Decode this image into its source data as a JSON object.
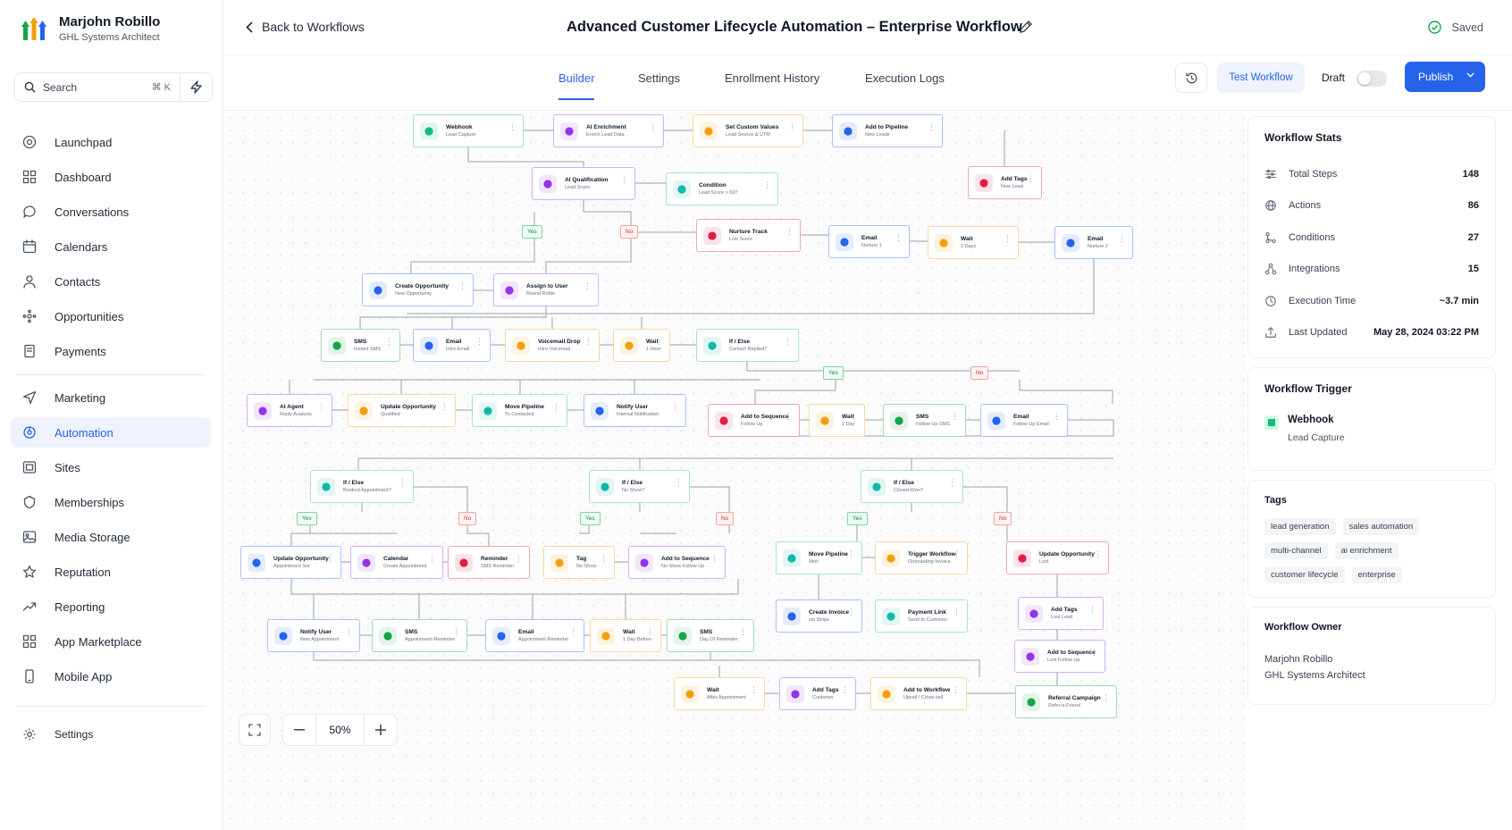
{
  "user": {
    "name": "Marjohn Robillo",
    "role": "GHL Systems Architect"
  },
  "search": {
    "label": "Search",
    "shortcut": "⌘ K"
  },
  "nav": {
    "main": [
      {
        "label": "Launchpad",
        "icon": "launchpad-icon"
      },
      {
        "label": "Dashboard",
        "icon": "dashboard-icon"
      },
      {
        "label": "Conversations",
        "icon": "chat-icon"
      },
      {
        "label": "Calendars",
        "icon": "calendar-icon"
      },
      {
        "label": "Contacts",
        "icon": "contacts-icon"
      },
      {
        "label": "Opportunities",
        "icon": "opportunities-icon"
      },
      {
        "label": "Payments",
        "icon": "payments-icon"
      }
    ],
    "secondary": [
      {
        "label": "Marketing",
        "icon": "send-icon"
      },
      {
        "label": "Automation",
        "icon": "automation-icon",
        "active": true
      },
      {
        "label": "Sites",
        "icon": "sites-icon"
      },
      {
        "label": "Memberships",
        "icon": "memberships-icon"
      },
      {
        "label": "Media Storage",
        "icon": "image-icon"
      },
      {
        "label": "Reputation",
        "icon": "star-icon"
      },
      {
        "label": "Reporting",
        "icon": "trend-icon"
      },
      {
        "label": "App Marketplace",
        "icon": "apps-icon"
      },
      {
        "label": "Mobile App",
        "icon": "phone-icon"
      }
    ],
    "settings": "Settings"
  },
  "header": {
    "back": "Back to Workflows",
    "title": "Advanced Customer Lifecycle Automation – Enterprise Workflow",
    "saved": "Saved"
  },
  "tabs": [
    "Builder",
    "Settings",
    "Enrollment History",
    "Execution Logs"
  ],
  "toolbar": {
    "test": "Test Workflow",
    "draft": "Draft",
    "publish": "Publish"
  },
  "zoom": {
    "level": "50%"
  },
  "colors": {
    "accent": "#2563eb",
    "yes": "#15803d",
    "no": "#dc2626"
  },
  "workflow": {
    "nodes": [
      {
        "title": "Webhook",
        "sub": "Lead Capture",
        "color": "#10b981"
      },
      {
        "title": "AI Enrichment",
        "sub": "Enrich Lead Data",
        "color": "#9333ea"
      },
      {
        "title": "Set Custom Values",
        "sub": "Lead Source & UTM",
        "color": "#f59e0b"
      },
      {
        "title": "Add to Pipeline",
        "sub": "New Leads",
        "color": "#2563eb"
      },
      {
        "title": "Add Tags",
        "sub": "New Lead",
        "color": "#e11d48"
      },
      {
        "title": "AI Qualification",
        "sub": "Lead Score",
        "color": "#9333ea"
      },
      {
        "title": "Condition",
        "sub": "Lead Score > 60?",
        "color": "#14b8a6"
      },
      {
        "title": "Nurture Track",
        "sub": "Low Score",
        "color": "#e11d48"
      },
      {
        "title": "Email",
        "sub": "Nurture 1",
        "color": "#2563eb"
      },
      {
        "title": "Wait",
        "sub": "2 Days",
        "color": "#f59e0b"
      },
      {
        "title": "Email",
        "sub": "Nurture 2",
        "color": "#2563eb"
      },
      {
        "title": "Create Opportunity",
        "sub": "New Opportunity",
        "color": "#2563eb"
      },
      {
        "title": "Assign to User",
        "sub": "Round Robin",
        "color": "#9333ea"
      },
      {
        "title": "SMS",
        "sub": "Instant SMS",
        "color": "#16a34a"
      },
      {
        "title": "Email",
        "sub": "Intro Email",
        "color": "#2563eb"
      },
      {
        "title": "Voicemail Drop",
        "sub": "Intro Voicemail",
        "color": "#f59e0b"
      },
      {
        "title": "Wait",
        "sub": "1 Hour",
        "color": "#f59e0b"
      },
      {
        "title": "If / Else",
        "sub": "Contact Replied?",
        "color": "#14b8a6"
      },
      {
        "title": "AI Agent",
        "sub": "Reply Analysis",
        "color": "#9333ea"
      },
      {
        "title": "Update Opportunity",
        "sub": "Qualified",
        "color": "#f59e0b"
      },
      {
        "title": "Move Pipeline",
        "sub": "To Contacted",
        "color": "#14b8a6"
      },
      {
        "title": "Notify User",
        "sub": "Internal Notification",
        "color": "#2563eb"
      },
      {
        "title": "Add to Sequence",
        "sub": "Follow Up",
        "color": "#e11d48"
      },
      {
        "title": "Wait",
        "sub": "1 Day",
        "color": "#f59e0b"
      },
      {
        "title": "SMS",
        "sub": "Follow Up SMS",
        "color": "#16a34a"
      },
      {
        "title": "Email",
        "sub": "Follow Up Email",
        "color": "#2563eb"
      },
      {
        "title": "If / Else",
        "sub": "Booked Appointment?",
        "color": "#14b8a6"
      },
      {
        "title": "If / Else",
        "sub": "No Show?",
        "color": "#14b8a6"
      },
      {
        "title": "If / Else",
        "sub": "Closed Won?",
        "color": "#14b8a6"
      },
      {
        "title": "Update Opportunity",
        "sub": "Appointment Set",
        "color": "#2563eb"
      },
      {
        "title": "Calendar",
        "sub": "Create Appointment",
        "color": "#9333ea"
      },
      {
        "title": "Reminder",
        "sub": "SMS Reminder",
        "color": "#e11d48"
      },
      {
        "title": "Tag",
        "sub": "No Show",
        "color": "#f59e0b"
      },
      {
        "title": "Add to Sequence",
        "sub": "No Show Follow Up",
        "color": "#9333ea"
      },
      {
        "title": "Move Pipeline",
        "sub": "Won",
        "color": "#14b8a6"
      },
      {
        "title": "Trigger Workflow",
        "sub": "Onboarding Invoice",
        "color": "#f59e0b"
      },
      {
        "title": "Update Opportunity",
        "sub": "Lost",
        "color": "#e11d48"
      },
      {
        "title": "Notify User",
        "sub": "New Appointment",
        "color": "#2563eb"
      },
      {
        "title": "SMS",
        "sub": "Appointment Reminder",
        "color": "#16a34a"
      },
      {
        "title": "Email",
        "sub": "Appointment Reminder",
        "color": "#2563eb"
      },
      {
        "title": "Wait",
        "sub": "1 Day Before",
        "color": "#f59e0b"
      },
      {
        "title": "SMS",
        "sub": "Day Of Reminder",
        "color": "#16a34a"
      },
      {
        "title": "Create Invoice",
        "sub": "via Stripe",
        "color": "#2563eb"
      },
      {
        "title": "Payment Link",
        "sub": "Send to Customer",
        "color": "#14b8a6"
      },
      {
        "title": "Add Tags",
        "sub": "Lost Lead",
        "color": "#9333ea"
      },
      {
        "title": "Add to Sequence",
        "sub": "Lost Follow Up",
        "color": "#9333ea"
      },
      {
        "title": "Wait",
        "sub": "After Appointment",
        "color": "#f59e0b"
      },
      {
        "title": "Add Tags",
        "sub": "Customer",
        "color": "#9333ea"
      },
      {
        "title": "Add to Workflow",
        "sub": "Upsell / Cross-sell",
        "color": "#f59e0b"
      },
      {
        "title": "Referral Campaign",
        "sub": "Refer-a-Friend",
        "color": "#16a34a"
      }
    ],
    "branches": [
      "Yes",
      "No",
      "Yes",
      "No",
      "Yes",
      "No",
      "Yes",
      "No",
      "Yes",
      "No"
    ]
  },
  "stats": {
    "title": "Workflow Stats",
    "items": [
      {
        "label": "Total Steps",
        "value": "148",
        "icon": "sliders-icon"
      },
      {
        "label": "Actions",
        "value": "86",
        "icon": "globe-icon"
      },
      {
        "label": "Conditions",
        "value": "27",
        "icon": "branch-icon"
      },
      {
        "label": "Integrations",
        "value": "15",
        "icon": "share-icon"
      },
      {
        "label": "Execution Time",
        "value": "~3.7 min",
        "icon": "clock-icon"
      },
      {
        "label": "Last Updated",
        "value": "May 28, 2024 03:22 PM",
        "icon": "upload-icon"
      }
    ]
  },
  "trigger": {
    "title": "Workflow Trigger",
    "name": "Webhook",
    "sub": "Lead Capture"
  },
  "tags": {
    "title": "Tags",
    "items": [
      "lead generation",
      "sales automation",
      "multi-channel",
      "ai enrichment",
      "customer lifecycle",
      "enterprise"
    ]
  },
  "owner": {
    "title": "Workflow Owner",
    "name": "Marjohn Robillo",
    "role": "GHL Systems Architect"
  }
}
